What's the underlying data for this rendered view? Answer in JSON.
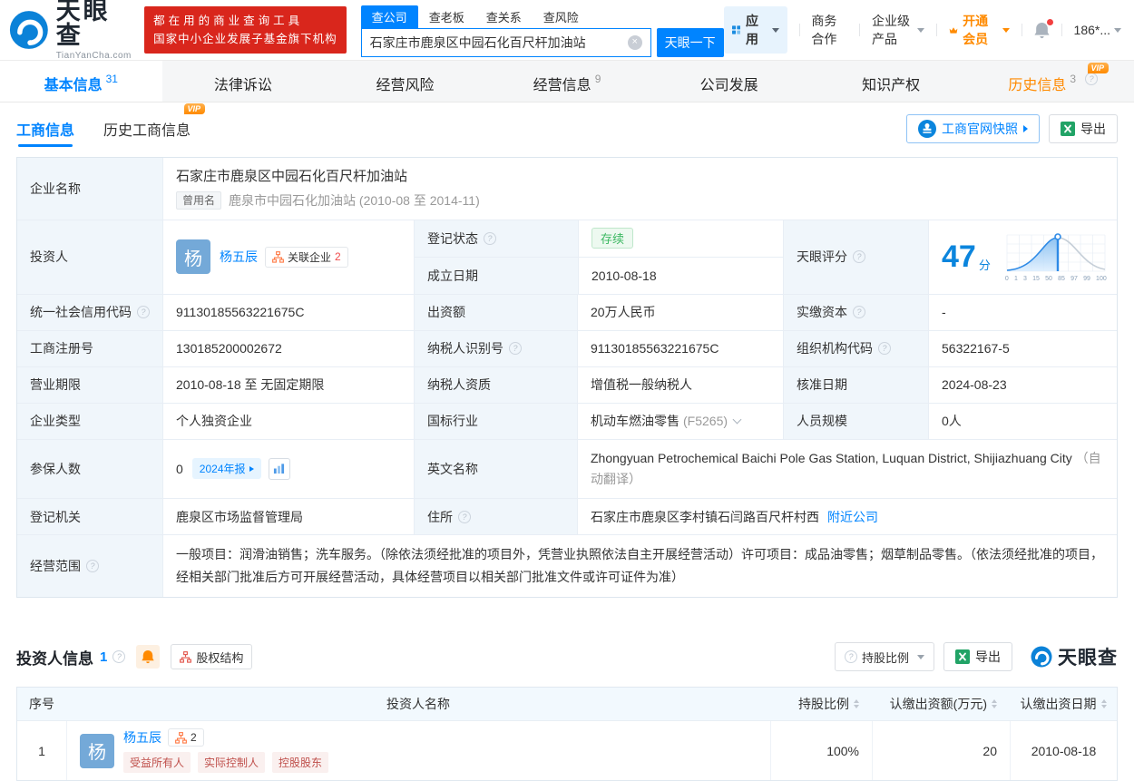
{
  "colors": {
    "brand_blue": "#0084ff",
    "vip_orange": "#ff8a00",
    "status_green": "#3bb861",
    "promo_red": "#d9261c",
    "avatar_blue": "#74a9d8"
  },
  "topbar": {
    "brand": "天眼查",
    "brand_domain": "TianYanCha.com",
    "promo_line1": "都在用的商业查询工具",
    "promo_line2": "国家中小企业发展子基金旗下机构",
    "search_tabs": [
      "查公司",
      "查老板",
      "查关系",
      "查风险"
    ],
    "search_value": "石家庄市鹿泉区中园石化百尺杆加油站",
    "search_button": "天眼一下",
    "apps": "应用",
    "biz_coop": "商务合作",
    "enterprise": "企业级产品",
    "vip_upgrade": "开通会员",
    "phone": "186*..."
  },
  "nav": {
    "vip_badge": "VIP",
    "tabs": [
      {
        "label": "基本信息",
        "count": "31"
      },
      {
        "label": "法律诉讼",
        "count": ""
      },
      {
        "label": "经营风险",
        "count": ""
      },
      {
        "label": "经营信息",
        "count": "9"
      },
      {
        "label": "公司发展",
        "count": ""
      },
      {
        "label": "知识产权",
        "count": ""
      },
      {
        "label": "历史信息",
        "count": "3"
      }
    ]
  },
  "toolbar": {
    "tab_business": "工商信息",
    "tab_history": "历史工商信息",
    "vip_badge": "VIP",
    "snapshot_button": "工商官网快照",
    "export_button": "导出"
  },
  "info": {
    "name": {
      "label": "企业名称",
      "value": "石家庄市鹿泉区中园石化百尺杆加油站",
      "former_tag": "曾用名",
      "former_value": "鹿泉市中园石化加油站 (2010-08 至 2014-11)"
    },
    "investor": {
      "label": "投资人",
      "avatar": "杨",
      "name": "杨五辰",
      "related_label": "关联企业",
      "related_count": "2"
    },
    "reg_status": {
      "label": "登记状态",
      "value": "存续"
    },
    "establish_date": {
      "label": "成立日期",
      "value": "2010-08-18"
    },
    "score": {
      "label": "天眼评分",
      "value": "47",
      "unit": "分",
      "axis_ticks": [
        "0",
        "1",
        "3",
        "15",
        "50",
        "85",
        "97",
        "99",
        "100"
      ]
    },
    "credit_code": {
      "label": "统一社会信用代码",
      "value": "91130185563221675C"
    },
    "contribution": {
      "label": "出资额",
      "value": "20万人民币"
    },
    "paid_capital": {
      "label": "实缴资本",
      "value": "-"
    },
    "reg_number": {
      "label": "工商注册号",
      "value": "130185200002672"
    },
    "taxpayer_id": {
      "label": "纳税人识别号",
      "value": "91130185563221675C"
    },
    "org_code": {
      "label": "组织机构代码",
      "value": "56322167-5"
    },
    "business_term": {
      "label": "营业期限",
      "value": "2010-08-18 至 无固定期限"
    },
    "taxpayer_quality": {
      "label": "纳税人资质",
      "value": "增值税一般纳税人"
    },
    "approval_date": {
      "label": "核准日期",
      "value": "2024-08-23"
    },
    "company_type": {
      "label": "企业类型",
      "value": "个人独资企业"
    },
    "industry": {
      "label": "国标行业",
      "value": "机动车燃油零售",
      "code": "(F5265)"
    },
    "staff_size": {
      "label": "人员规模",
      "value": "0人"
    },
    "insured": {
      "label": "参保人数",
      "value": "0",
      "report_button": "2024年报"
    },
    "english_name": {
      "label": "英文名称",
      "value": "Zhongyuan Petrochemical Baichi Pole Gas Station, Luquan District, Shijiazhuang City",
      "note": "（自动翻译）"
    },
    "reg_authority": {
      "label": "登记机关",
      "value": "鹿泉区市场监督管理局"
    },
    "address": {
      "label": "住所",
      "value": "石家庄市鹿泉区李村镇石闫路百尺杆村西",
      "nearby_link": "附近公司"
    },
    "business_scope": {
      "label": "经营范围",
      "value": "一般项目：润滑油销售；洗车服务。（除依法须经批准的项目外，凭营业执照依法自主开展经营活动）许可项目：成品油零售；烟草制品零售。（依法须经批准的项目，经相关部门批准后方可开展经营活动，具体经营项目以相关部门批准文件或许可证件为准）"
    }
  },
  "investors_section": {
    "title": "投资人信息",
    "count": "1",
    "equity_button": "股权结构",
    "ratio_filter": "持股比例",
    "export_button": "导出",
    "brand": "天眼查",
    "columns": {
      "index": "序号",
      "name": "投资人名称",
      "ratio": "持股比例",
      "amount": "认缴出资额(万元)",
      "date": "认缴出资日期"
    },
    "rows": [
      {
        "index": "1",
        "avatar": "杨",
        "name": "杨五辰",
        "badge_count": "2",
        "tags": [
          "受益所有人",
          "实际控制人",
          "控股股东"
        ],
        "ratio": "100%",
        "amount": "20",
        "date": "2010-08-18"
      }
    ]
  }
}
